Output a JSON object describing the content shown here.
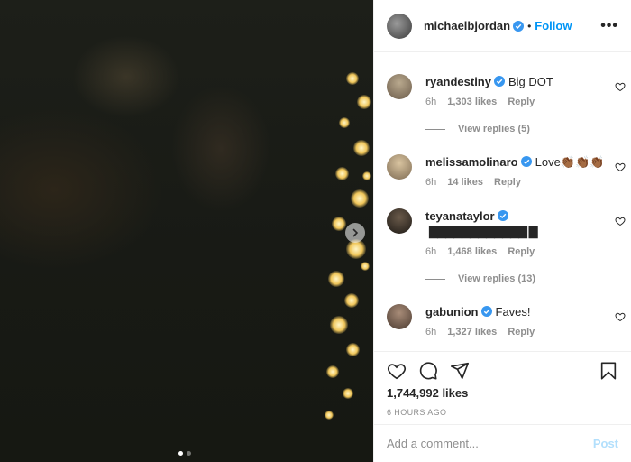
{
  "post": {
    "username": "michaelbjordan",
    "separator": "•",
    "follow_label": "Follow",
    "more_label": "•••",
    "carousel": {
      "slide_count": 2,
      "active_slide": 1
    }
  },
  "comments": [
    {
      "username": "ryandestiny",
      "text": "Big DOT",
      "time": "6h",
      "likes": "1,303 likes",
      "reply": "Reply",
      "view_replies": "View replies (5)"
    },
    {
      "username": "melissamolinaro",
      "text": "Love👏🏾👏🏾👏🏾",
      "time": "6h",
      "likes": "14 likes",
      "reply": "Reply"
    },
    {
      "username": "teyanataylor",
      "text": "▇▇▇▇▇▇▇▇▇▇▇▇ ▇",
      "time": "6h",
      "likes": "1,468 likes",
      "reply": "Reply",
      "view_replies": "View replies (13)"
    },
    {
      "username": "gabunion",
      "text": "Faves!",
      "time": "6h",
      "likes": "1,327 likes",
      "reply": "Reply"
    }
  ],
  "stats": {
    "likes": "1,744,992 likes",
    "time_ago": "6 HOURS AGO"
  },
  "composer": {
    "placeholder": "Add a comment...",
    "post_label": "Post"
  },
  "colors": {
    "accent": "#0095f6",
    "verified": "#3897f0",
    "muted": "#8e8e8e",
    "post_disabled": "#b2dffc"
  }
}
